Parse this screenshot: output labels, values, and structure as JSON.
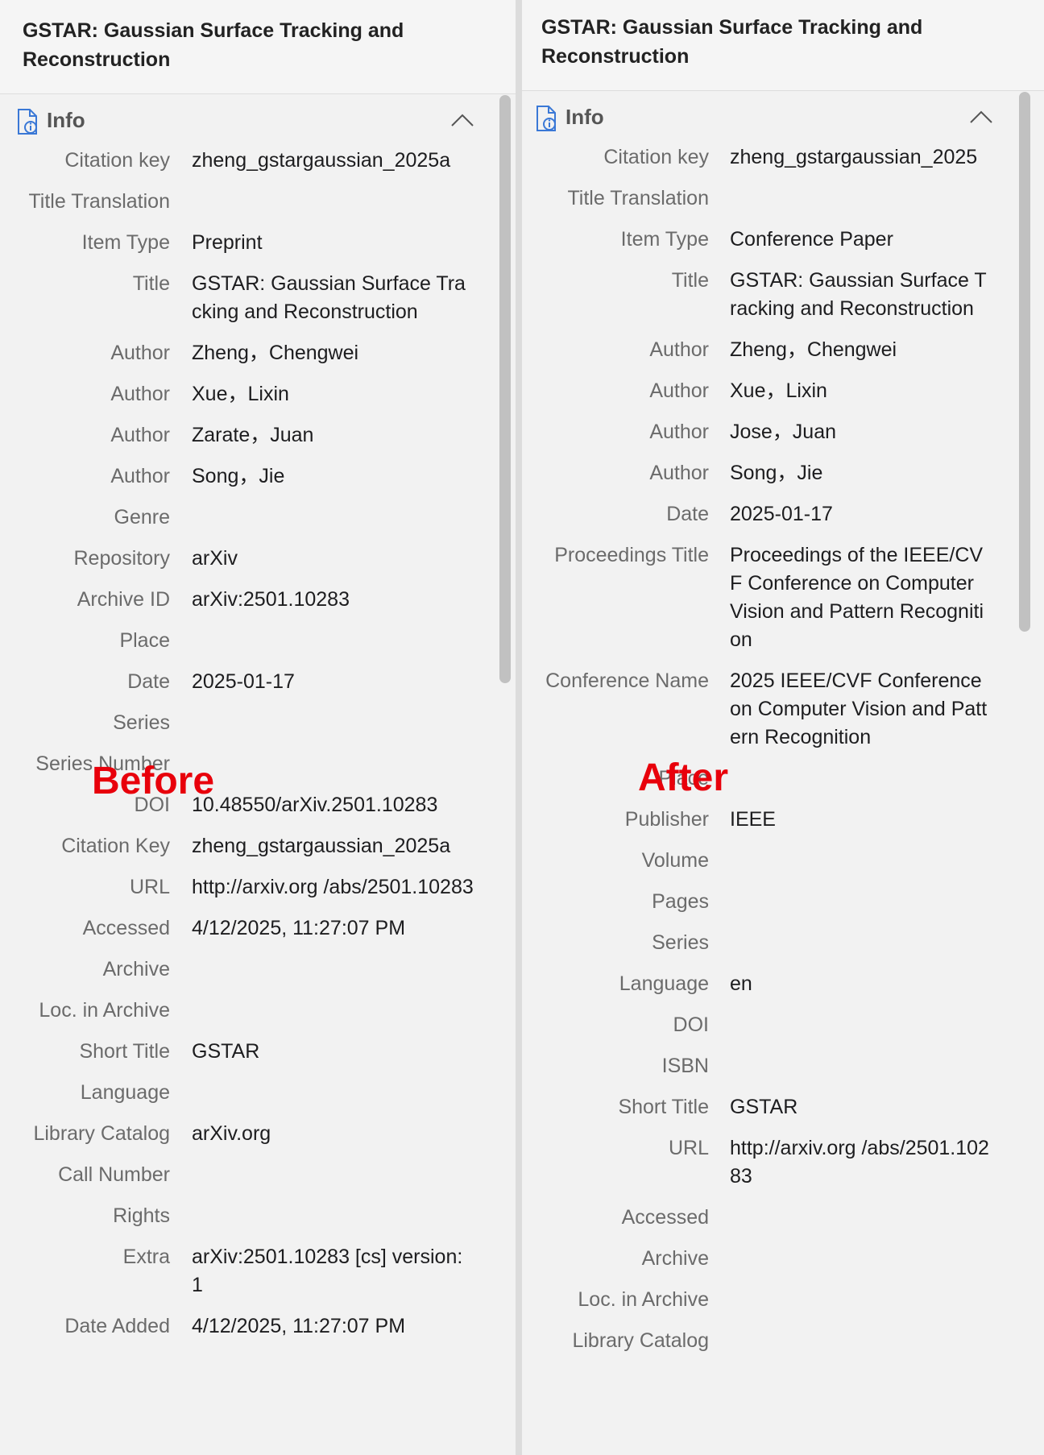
{
  "overlays": {
    "before": "Before",
    "after": "After"
  },
  "left": {
    "header_title": "GSTAR: Gaussian Surface Tracking and Reconstruction",
    "section_label": "Info",
    "fields": [
      {
        "label": "Citation key",
        "value": "zheng_gstargaussian_2025a"
      },
      {
        "label": "Title Translation",
        "value": ""
      },
      {
        "label": "Item Type",
        "value": "Preprint"
      },
      {
        "label": "Title",
        "value": "GSTAR: Gaussian Surface Tracking and Reconstruction"
      },
      {
        "label": "Author",
        "value": "Zheng，Chengwei"
      },
      {
        "label": "Author",
        "value": "Xue，Lixin"
      },
      {
        "label": "Author",
        "value": "Zarate，Juan"
      },
      {
        "label": "Author",
        "value": "Song，Jie"
      },
      {
        "label": "Genre",
        "value": ""
      },
      {
        "label": "Repository",
        "value": "arXiv"
      },
      {
        "label": "Archive ID",
        "value": "arXiv:2501.10283"
      },
      {
        "label": "Place",
        "value": ""
      },
      {
        "label": "Date",
        "value": "2025-01-17"
      },
      {
        "label": "Series",
        "value": ""
      },
      {
        "label": "Series Number",
        "value": ""
      },
      {
        "label": "DOI",
        "value": "10.48550/arXiv.2501.10283"
      },
      {
        "label": "Citation Key",
        "value": "zheng_gstargaussian_2025a"
      },
      {
        "label": "URL",
        "value": "http://arxiv.org /abs/2501.10283"
      },
      {
        "label": "Accessed",
        "value": "4/12/2025, 11:27:07 PM"
      },
      {
        "label": "Archive",
        "value": ""
      },
      {
        "label": "Loc. in Archive",
        "value": ""
      },
      {
        "label": "Short Title",
        "value": "GSTAR"
      },
      {
        "label": "Language",
        "value": ""
      },
      {
        "label": "Library Catalog",
        "value": "arXiv.org"
      },
      {
        "label": "Call Number",
        "value": ""
      },
      {
        "label": "Rights",
        "value": ""
      },
      {
        "label": "Extra",
        "value": "arXiv:2501.10283 [cs] version: 1"
      },
      {
        "label": "Date Added",
        "value": "4/12/2025, 11:27:07 PM"
      }
    ]
  },
  "right": {
    "header_title": "GSTAR: Gaussian Surface Tracking and Reconstruction",
    "section_label": "Info",
    "fields": [
      {
        "label": "Citation key",
        "value": "zheng_gstargaussian_2025"
      },
      {
        "label": "Title Translation",
        "value": ""
      },
      {
        "label": "Item Type",
        "value": "Conference Paper"
      },
      {
        "label": "Title",
        "value": "GSTAR: Gaussian Surface Tracking and Reconstruction"
      },
      {
        "label": "Author",
        "value": "Zheng，Chengwei"
      },
      {
        "label": "Author",
        "value": "Xue，Lixin"
      },
      {
        "label": "Author",
        "value": "Jose，Juan"
      },
      {
        "label": "Author",
        "value": "Song，Jie"
      },
      {
        "label": "Date",
        "value": "2025-01-17"
      },
      {
        "label": "Proceedings Title",
        "value": "Proceedings of the IEEE/CVF Conference on Computer Vision and Pattern Recognition"
      },
      {
        "label": "Conference Name",
        "value": "2025 IEEE/CVF Conference on Computer Vision and Pattern Recognition"
      },
      {
        "label": "Place",
        "value": ""
      },
      {
        "label": "Publisher",
        "value": "IEEE"
      },
      {
        "label": "Volume",
        "value": ""
      },
      {
        "label": "Pages",
        "value": ""
      },
      {
        "label": "Series",
        "value": ""
      },
      {
        "label": "Language",
        "value": "en"
      },
      {
        "label": "DOI",
        "value": ""
      },
      {
        "label": "ISBN",
        "value": ""
      },
      {
        "label": "Short Title",
        "value": "GSTAR"
      },
      {
        "label": "URL",
        "value": "http://arxiv.org /abs/2501.10283"
      },
      {
        "label": "Accessed",
        "value": ""
      },
      {
        "label": "Archive",
        "value": ""
      },
      {
        "label": "Loc. in Archive",
        "value": ""
      },
      {
        "label": "Library Catalog",
        "value": ""
      }
    ]
  }
}
